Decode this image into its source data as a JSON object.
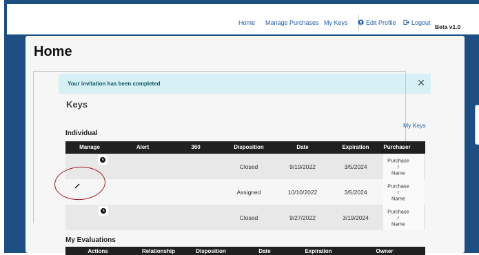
{
  "nav": {
    "home": "Home",
    "manage_purchases": "Manage Purchases",
    "my_keys": "My Keys",
    "edit_profile": "Edit Profile",
    "logout": "Logout",
    "beta": "Beta v1.0"
  },
  "page": {
    "title": "Home"
  },
  "alert": {
    "message": "Your invitation has been completed",
    "close_symbol": "✕"
  },
  "keys": {
    "legend": "Keys",
    "my_keys_link": "My Keys",
    "individual_title": "Individual",
    "columns": [
      "Manage",
      "Alert",
      "360",
      "Disposition",
      "Date",
      "Expiration",
      "Purchaser"
    ],
    "rows": [
      {
        "disposition": "Closed",
        "date": "9/19/2022",
        "expiration": "3/5/2024",
        "purchaser": [
          "Purchase",
          "r",
          "Name"
        ],
        "manage_icon": "clock-icon"
      },
      {
        "disposition": "Assigned",
        "date": "10/10/2022",
        "expiration": "3/5/2024",
        "purchaser": [
          "Purchase",
          "r",
          "Name"
        ],
        "manage_icon": "pencil-icon"
      },
      {
        "disposition": "Closed",
        "date": "9/27/2022",
        "expiration": "3/19/2024",
        "purchaser": [
          "Purchase",
          "r",
          "Name"
        ],
        "manage_icon": "clock-icon"
      }
    ]
  },
  "evaluations": {
    "title": "My Evaluations",
    "columns": [
      "Actions",
      "Relationship",
      "Disposition",
      "Date",
      "Expiration",
      "Owner"
    ]
  },
  "colors": {
    "frame": "#1e4f82",
    "nav_link": "#1f5ea8",
    "alert_bg": "#d7f0f6",
    "table_header": "#202020",
    "annotation": "#a3141e"
  }
}
